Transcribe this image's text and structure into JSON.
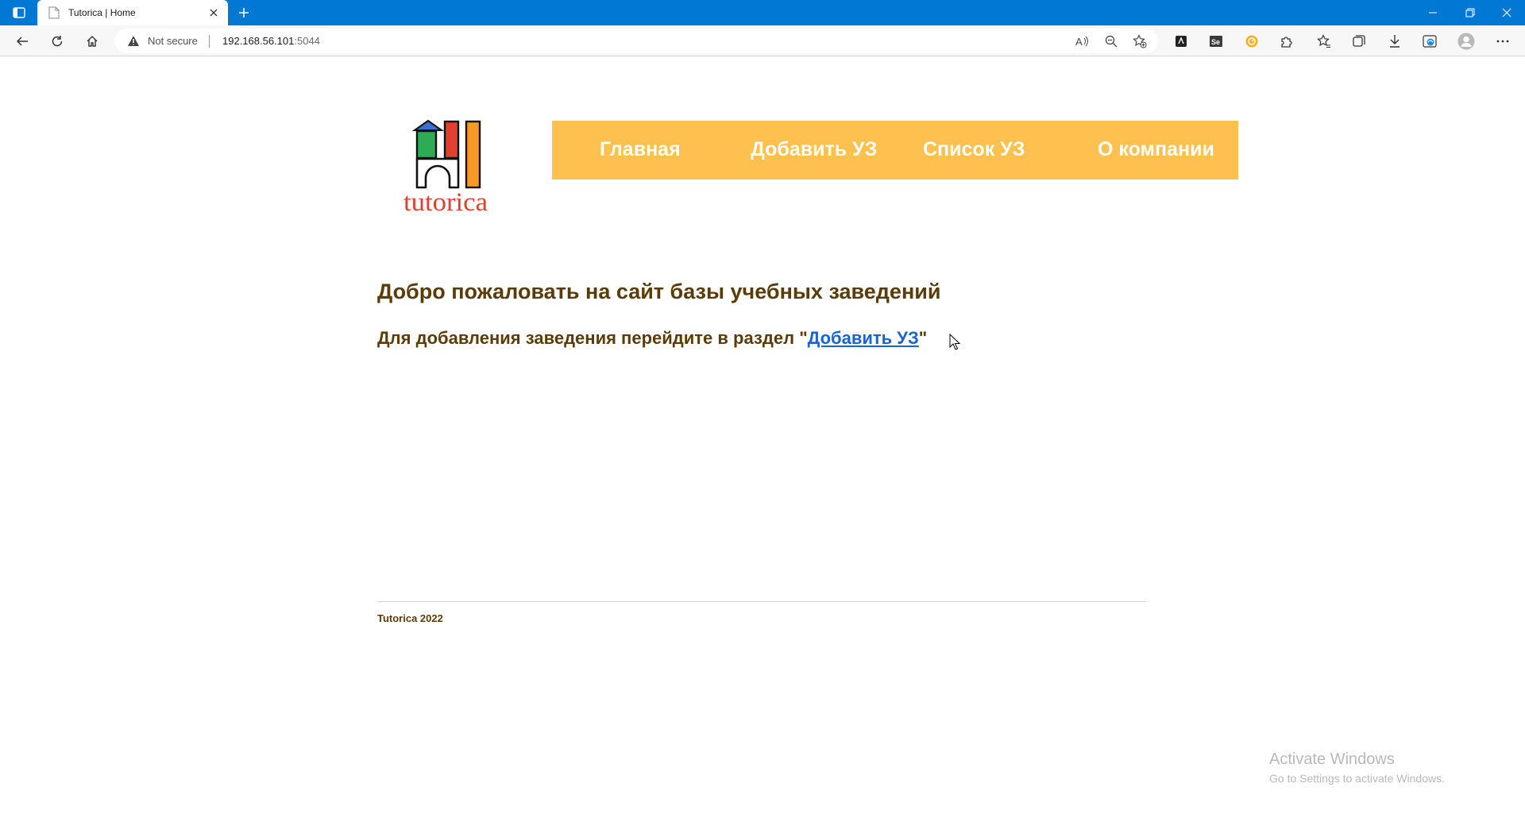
{
  "browser": {
    "tab_title": "Tutorica | Home",
    "security_label": "Not secure",
    "url_host": "192.168.56.101",
    "url_port": ":5044"
  },
  "site": {
    "logo_text": "tutorica",
    "nav": [
      {
        "label": "Главная"
      },
      {
        "label": "Добавить УЗ"
      },
      {
        "label": "Список УЗ"
      },
      {
        "label": "О компании"
      }
    ],
    "heading": "Добро пожаловать на сайт базы учебных заведений",
    "subline_prefix": "Для добавления заведения перейдите в раздел \"",
    "subline_link": "Добавить УЗ",
    "subline_suffix": "\"",
    "footer": "Tutorica 2022",
    "colors": {
      "nav_bg": "#fec04f",
      "text": "#5a3c08",
      "link": "#1664d8"
    }
  },
  "watermark": {
    "line1": "Activate Windows",
    "line2": "Go to Settings to activate Windows."
  }
}
